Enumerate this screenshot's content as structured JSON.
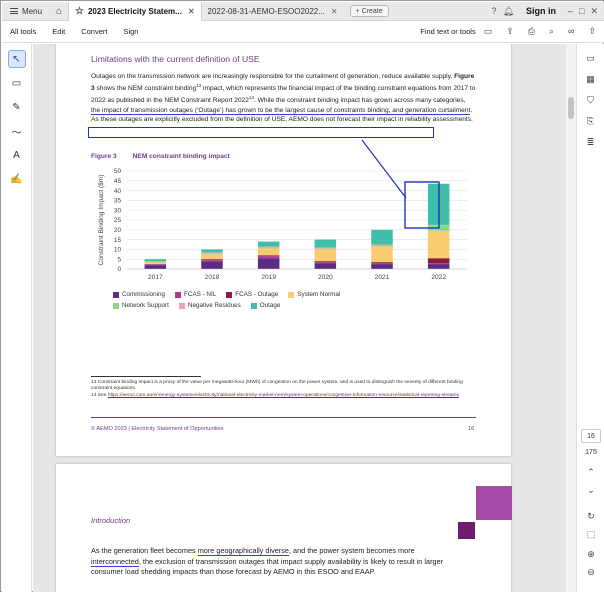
{
  "tabbar": {
    "menu_label": "Menu",
    "tab1_label": "2023 Electricity Statem...",
    "tab2_label": "2022-08-31-AEMO-ESOO2022...",
    "create_label": "Create",
    "signin_label": "Sign in"
  },
  "toolbar": {
    "all_tools": "All tools",
    "edit": "Edit",
    "convert": "Convert",
    "sign": "Sign",
    "find": "Find text or tools"
  },
  "doc": {
    "section_heading": "Limitations with the current definition of USE",
    "para_1": "Outages on the transmission network are increasingly responsible for the curtailment of generation, reduce available supply. ",
    "para_fig": "Figure 3",
    "para_2": " shows the NEM constraint binding",
    "para_sup1": "13",
    "para_3": " impact, which represents the financial impact of the binding constraint equations from 2017 to 2022 as published in the NEM Constraint Report 2022",
    "para_sup2": "14",
    "para_4": ". While the constraint binding impact has grown across many categories, ",
    "para_ul": "the impact of transmission outages (‘Outage’) has grown to be the largest cause of constraints binding, and generation curtailment",
    "para_5": ". As these outages are explicitly excluded from the definition of USE, AEMO does not forecast their impact in reliability assessments.",
    "figure_label": "Figure 3",
    "figure_title": "NEM constraint binding impact",
    "footnote_1": "13 Constraint binding impact is a proxy of the value per megawatt-hour (MWh) of congestion on the power system, and is used to distinguish the severity of different binding constraint equations.",
    "footnote_2_prefix": "14 See ",
    "footnote_2_link": "https://aemo.com.au/en/energy-systems/electricity/national-electricity-market-nem/system-operations/congestion-information-resource/statistical-reporting-streams",
    "footer_left": "© AEMO 2023 | Electricity Statement of Opportunities",
    "footer_right": "16",
    "p2_heading": "Introduction",
    "p2_text_1": "As the generation fleet becomes ",
    "p2_ul_1": "more geographically diverse",
    "p2_text_2": ", and the power system becomes more ",
    "p2_ul_2": "interconnected",
    "p2_text_3": ", the exclusion of transmission outages that impact supply availability is likely to result in larger consumer load shedding impacts than those forecast by AEMO in this ESOO and EAAP."
  },
  "pager": {
    "current": "16",
    "total": "175"
  },
  "colors": {
    "accent_purple": "#6b3c8c",
    "highlight_blue": "#2233b8"
  },
  "chart_data": {
    "type": "bar",
    "stacked": true,
    "categories": [
      "2017",
      "2018",
      "2019",
      "2020",
      "2021",
      "2022"
    ],
    "ylabel": "Constraint Binding Impact ($m)",
    "ylim": [
      0,
      50
    ],
    "yticks": [
      0,
      5,
      10,
      15,
      20,
      25,
      30,
      35,
      40,
      45,
      50
    ],
    "grid": true,
    "legend_position": "bottom",
    "series": [
      {
        "name": "Commissioning",
        "color": "#5b2d82",
        "values": [
          2,
          4,
          5.5,
          3,
          2.5,
          2.5
        ]
      },
      {
        "name": "FCAS - NIL",
        "color": "#b23a8e",
        "values": [
          0.5,
          0.5,
          1,
          0.5,
          0.5,
          0.5
        ]
      },
      {
        "name": "FCAS - Outage",
        "color": "#8b1a3a",
        "values": [
          0,
          0.5,
          0.5,
          0.5,
          0.5,
          2.5
        ]
      },
      {
        "name": "System Normal",
        "color": "#f9cc72",
        "values": [
          1,
          2.5,
          3.5,
          6,
          8,
          14
        ]
      },
      {
        "name": "Network Support",
        "color": "#96d386",
        "values": [
          0.5,
          0.5,
          0.5,
          0.5,
          0.5,
          2.5
        ]
      },
      {
        "name": "Negative Residues",
        "color": "#f2a3b3",
        "values": [
          0,
          0.5,
          0.5,
          0.5,
          0.5,
          0.5
        ]
      },
      {
        "name": "Outage",
        "color": "#3dbfaa",
        "values": [
          1,
          1.5,
          2.5,
          4,
          7.5,
          21
        ]
      }
    ]
  }
}
